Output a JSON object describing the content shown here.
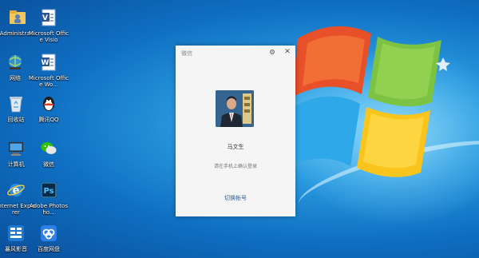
{
  "desktop": {
    "icons": [
      {
        "label": "Administra..."
      },
      {
        "label": "Microsoft Office Visio"
      },
      {
        "label": "网络"
      },
      {
        "label": "Microsoft Office Wo..."
      },
      {
        "label": "回收站"
      },
      {
        "label": "腾讯QQ"
      },
      {
        "label": "计算机"
      },
      {
        "label": "微信"
      },
      {
        "label": "Internet Explorer"
      },
      {
        "label": "Adobe Photosho..."
      },
      {
        "label": "暴风影音"
      },
      {
        "label": "百度网盘"
      }
    ]
  },
  "wechat_login": {
    "title": "微信",
    "settings_icon": "gear-icon",
    "close_label": "✕",
    "user_name": "马文生",
    "hint": "请在手机上确认登录",
    "switch_account": "切换帐号"
  },
  "colors": {
    "desktop_blue": "#1a7fd0",
    "dialog_bg": "#f5f5f5",
    "link_blue": "#2f5f9a"
  }
}
